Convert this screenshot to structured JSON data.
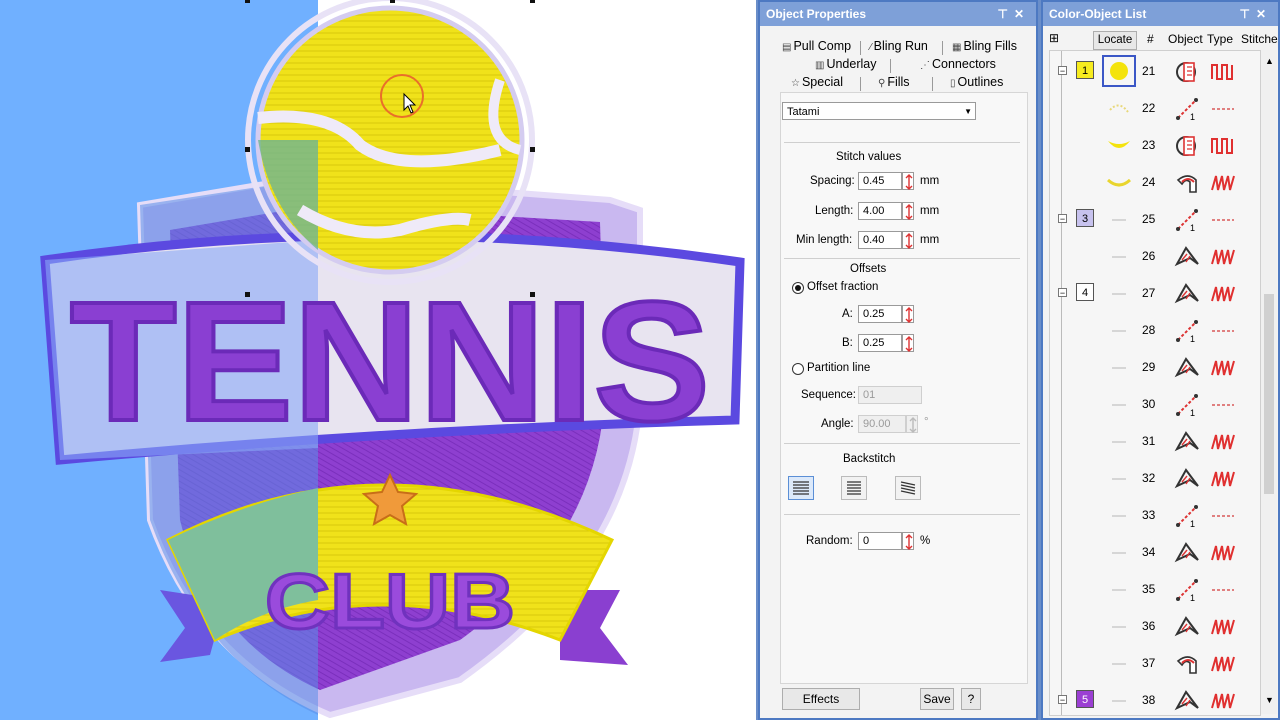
{
  "canvas": {
    "design_text_top": "TENNIS",
    "design_text_bottom": "CLUB"
  },
  "object_properties": {
    "title": "Object Properties",
    "tabs": [
      {
        "label": "Pull Comp",
        "icon": "pull-comp-icon"
      },
      {
        "label": "Bling Run",
        "icon": "bling-run-icon"
      },
      {
        "label": "Bling Fills",
        "icon": "bling-fills-icon"
      },
      {
        "label": "Underlay",
        "icon": "underlay-icon"
      },
      {
        "label": "Connectors",
        "icon": "connectors-icon"
      },
      {
        "label": "Special",
        "icon": "star-icon"
      },
      {
        "label": "Fills",
        "icon": "fills-icon"
      },
      {
        "label": "Outlines",
        "icon": "outlines-icon"
      }
    ],
    "active_tab": "Fills",
    "fill_type": "Tatami",
    "stitch_values_heading": "Stitch values",
    "spacing_label": "Spacing:",
    "spacing_value": "0.45",
    "length_label": "Length:",
    "length_value": "4.00",
    "min_length_label": "Min length:",
    "min_length_value": "0.40",
    "unit": "mm",
    "offsets_heading": "Offsets",
    "offset_fraction_label": "Offset fraction",
    "a_label": "A:",
    "a_value": "0.25",
    "b_label": "B:",
    "b_value": "0.25",
    "partition_line_label": "Partition line",
    "sequence_label": "Sequence:",
    "sequence_value": "01",
    "angle_label": "Angle:",
    "angle_value": "90.00",
    "angle_unit": "°",
    "backstitch_heading": "Backstitch",
    "random_label": "Random:",
    "random_value": "0",
    "random_unit": "%",
    "effects_button": "Effects",
    "save_button": "Save",
    "help_button": "?"
  },
  "color_object_list": {
    "title": "Color-Object List",
    "locate_button": "Locate",
    "col_number": "#",
    "col_object": "Object",
    "col_type": "Type",
    "col_stitches": "Stitche",
    "color_blocks": [
      {
        "label": "1",
        "color": "#f7ec1e"
      },
      {
        "label": "3",
        "color": "#c7c2ee"
      },
      {
        "label": "4",
        "color": "#ffffff"
      },
      {
        "label": "5",
        "color": "#9b3fd3"
      }
    ],
    "rows": [
      {
        "no": "21",
        "object": "complex-fill-icon",
        "type": "tatami-icon"
      },
      {
        "no": "22",
        "object": "run-icon",
        "type": "run-stitch-icon"
      },
      {
        "no": "23",
        "object": "complex-fill-icon",
        "type": "tatami-icon"
      },
      {
        "no": "24",
        "object": "column-icon",
        "type": "satin-icon"
      },
      {
        "no": "25",
        "object": "run-icon",
        "type": "run-stitch-icon"
      },
      {
        "no": "26",
        "object": "column-shape-icon",
        "type": "satin-icon"
      },
      {
        "no": "27",
        "object": "column-shape-icon",
        "type": "satin-icon"
      },
      {
        "no": "28",
        "object": "run-icon",
        "type": "run-stitch-icon"
      },
      {
        "no": "29",
        "object": "column-shape-icon",
        "type": "satin-icon"
      },
      {
        "no": "30",
        "object": "run-icon",
        "type": "run-stitch-icon"
      },
      {
        "no": "31",
        "object": "column-shape-icon",
        "type": "satin-icon"
      },
      {
        "no": "32",
        "object": "column-shape-icon",
        "type": "satin-icon"
      },
      {
        "no": "33",
        "object": "run-icon",
        "type": "run-stitch-icon"
      },
      {
        "no": "34",
        "object": "column-shape-icon",
        "type": "satin-icon"
      },
      {
        "no": "35",
        "object": "run-icon",
        "type": "run-stitch-icon"
      },
      {
        "no": "36",
        "object": "column-shape-icon",
        "type": "satin-icon"
      },
      {
        "no": "37",
        "object": "column-icon",
        "type": "satin-icon"
      },
      {
        "no": "38",
        "object": "column-shape-icon",
        "type": "satin-icon"
      }
    ]
  }
}
